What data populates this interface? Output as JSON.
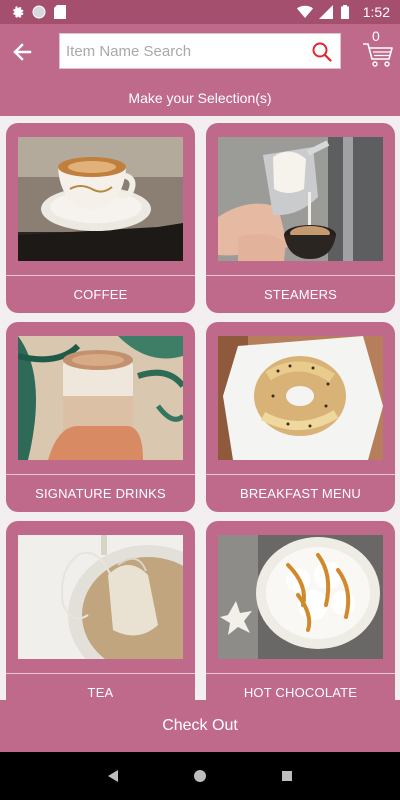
{
  "status_bar": {
    "time": "1:52"
  },
  "search": {
    "placeholder": "Item Name Search",
    "value": ""
  },
  "cart": {
    "count": "0"
  },
  "header": {
    "title": "Make your Selection(s)"
  },
  "categories": [
    {
      "label": "COFFEE"
    },
    {
      "label": "STEAMERS"
    },
    {
      "label": "SIGNATURE DRINKS"
    },
    {
      "label": "BREAKFAST MENU"
    },
    {
      "label": "TEA"
    },
    {
      "label": "HOT CHOCOLATE"
    }
  ],
  "footer": {
    "checkout_label": "Check Out"
  },
  "colors": {
    "primary": "#c06a8b",
    "status_bar": "#a54f6e",
    "background": "#f3eef0",
    "search_icon": "#e0262e"
  }
}
